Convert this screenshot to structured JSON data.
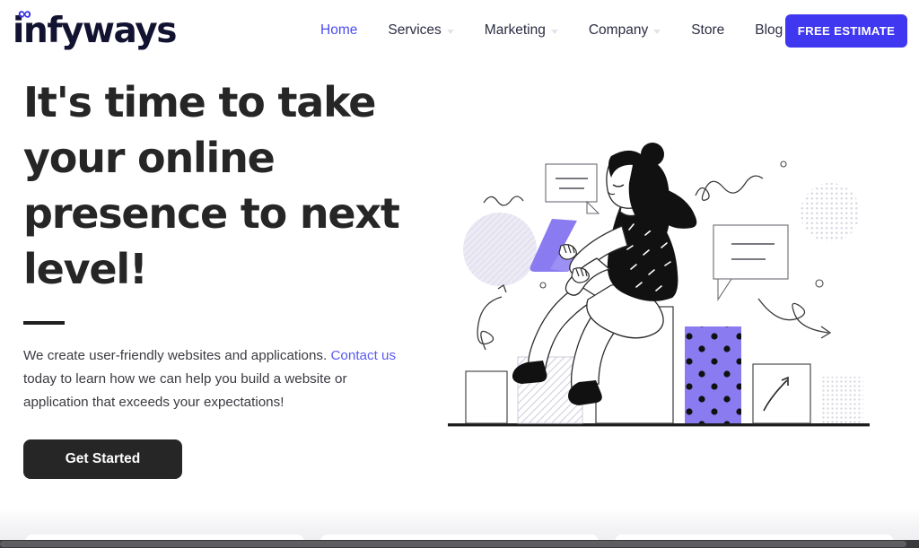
{
  "brand": {
    "name": "infyways",
    "infinity_glyph": "∞",
    "infinity_color": "#3c32e6",
    "word_color": "#121331"
  },
  "header": {
    "nav": [
      {
        "label": "Home",
        "active": true,
        "has_dropdown": false
      },
      {
        "label": "Services",
        "active": false,
        "has_dropdown": true
      },
      {
        "label": "Marketing",
        "active": false,
        "has_dropdown": true
      },
      {
        "label": "Company",
        "active": false,
        "has_dropdown": true
      },
      {
        "label": "Store",
        "active": false,
        "has_dropdown": false
      },
      {
        "label": "Blog",
        "active": false,
        "has_dropdown": false
      }
    ],
    "cta_label": "FREE ESTIMATE",
    "cta_color": "#4037f0",
    "active_color": "#4b4bf2"
  },
  "hero": {
    "title": "It's time to take your online presence to next level!",
    "description_part1": "We create user-friendly websites and applications. ",
    "link_text": "Contact us",
    "description_part2": " today to learn how we can help you build a website or application that exceeds your expectations!",
    "button_label": "Get Started",
    "button_color": "#262626",
    "link_color": "#5a5af0",
    "title_color": "#262626"
  },
  "illustration": {
    "name": "woman-on-bar-chart-with-laptop",
    "accent_purple": "#8b7bf0",
    "line_color": "#2b2b2b",
    "bars": [
      {
        "name": "bar-1-outline",
        "fill": "none"
      },
      {
        "name": "bar-2-diagonal-hatch",
        "fill": "diagonal-hatch"
      },
      {
        "name": "bar-3-outline-tall",
        "fill": "none"
      },
      {
        "name": "bar-4-purple-dots",
        "fill": "#8b7bf0"
      },
      {
        "name": "bar-5-arrow",
        "fill": "none"
      },
      {
        "name": "bar-6-dot-texture",
        "fill": "dot-texture"
      }
    ],
    "decorations": [
      "speech-bubble-top-left",
      "speech-bubble-right",
      "hatched-circle-left",
      "dotted-circle-top-right",
      "squiggle-left",
      "squiggle-top-right",
      "curved-arrow-left",
      "curved-arrow-right",
      "small-circle-1",
      "small-circle-2",
      "small-circle-3"
    ]
  },
  "next_section": {
    "card_count": 3
  },
  "scrollbar": {
    "orientation": "horizontal",
    "track_color": "#3a3a3c",
    "thumb_color": "#5e5e61"
  }
}
